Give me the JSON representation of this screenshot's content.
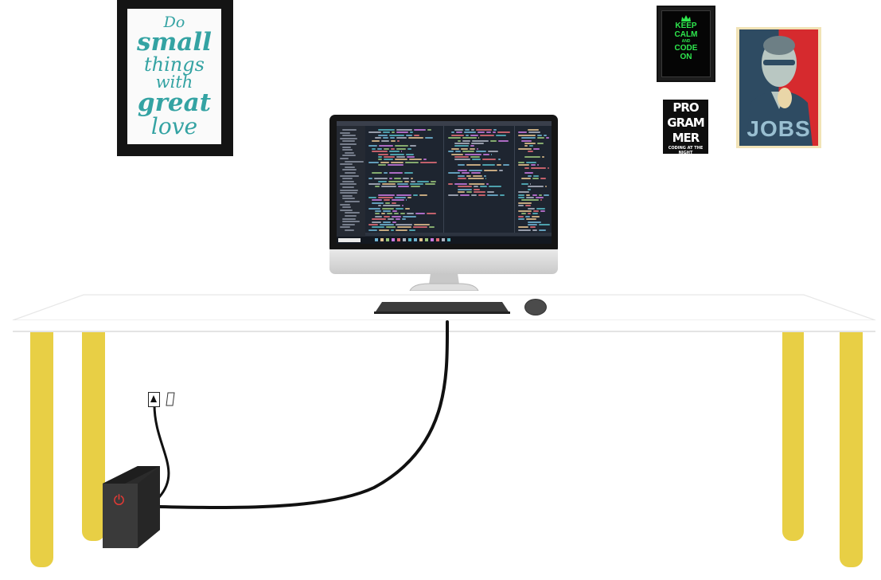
{
  "posters": {
    "quote_lines": [
      "Do",
      "small",
      "things",
      "with",
      "great",
      "love"
    ],
    "keep_calm_lines": [
      "KEEP",
      "CALM",
      "AND",
      "CODE",
      "ON"
    ],
    "programmer_lines": [
      "PRO",
      "GRAM",
      "MER"
    ],
    "programmer_tagline": "CODING AT THE NIGHT",
    "jobs_word": "JOBS"
  },
  "colors": {
    "wall": "#ffffff",
    "desk_legs": "#e8cf45",
    "keep_calm_text": "#2ee64d",
    "quote_text": "#34a3a3",
    "power_icon": "#e53935",
    "editor_background": "#1e2530"
  },
  "icons": [
    "crown-icon",
    "power-icon",
    "plug-icon"
  ]
}
